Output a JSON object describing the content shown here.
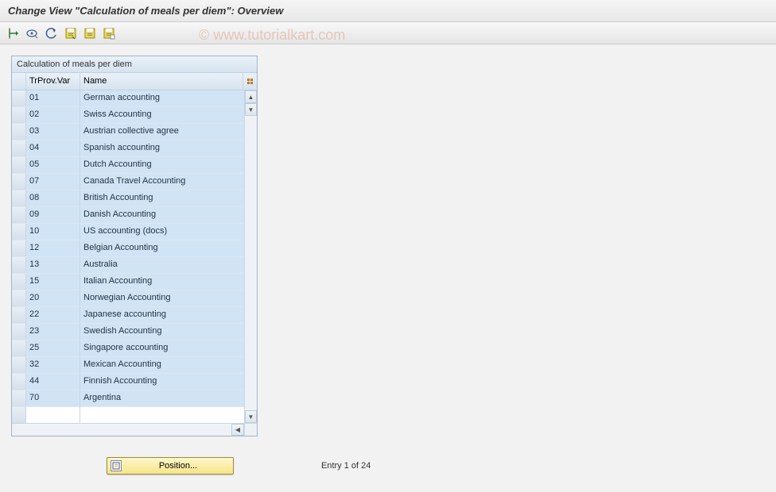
{
  "title": "Change View \"Calculation of meals per diem\": Overview",
  "watermark": "© www.tutorialkart.com",
  "toolbar": {
    "icons": [
      "toggle-display",
      "select-block",
      "undo",
      "save",
      "new-entries",
      "copy"
    ]
  },
  "table": {
    "panel_title": "Calculation of meals per diem",
    "col1_header": "TrProv.Var",
    "col2_header": "Name",
    "rows": [
      {
        "var": "01",
        "name": "German accounting"
      },
      {
        "var": "02",
        "name": "Swiss Accounting"
      },
      {
        "var": "03",
        "name": "Austrian collective agree"
      },
      {
        "var": "04",
        "name": "Spanish accounting"
      },
      {
        "var": "05",
        "name": "Dutch Accounting"
      },
      {
        "var": "07",
        "name": "Canada Travel Accounting"
      },
      {
        "var": "08",
        "name": "British Accounting"
      },
      {
        "var": "09",
        "name": "Danish Accounting"
      },
      {
        "var": "10",
        "name": "US accounting (docs)"
      },
      {
        "var": "12",
        "name": "Belgian Accounting"
      },
      {
        "var": "13",
        "name": "Australia"
      },
      {
        "var": "15",
        "name": "Italian Accounting"
      },
      {
        "var": "20",
        "name": "Norwegian Accounting"
      },
      {
        "var": "22",
        "name": "Japanese accounting"
      },
      {
        "var": "23",
        "name": "Swedish Accounting"
      },
      {
        "var": "25",
        "name": "Singapore accounting"
      },
      {
        "var": "32",
        "name": "Mexican Accounting"
      },
      {
        "var": "44",
        "name": "Finnish Accounting"
      },
      {
        "var": "70",
        "name": "Argentina"
      }
    ]
  },
  "footer": {
    "position_label": "Position...",
    "entry_status": "Entry 1 of 24"
  }
}
